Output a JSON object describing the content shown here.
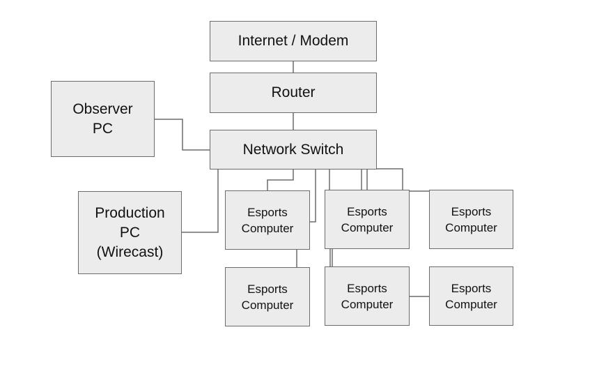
{
  "nodes": {
    "internet": "Internet / Modem",
    "router": "Router",
    "observer": "Observer\nPC",
    "switch": "Network Switch",
    "production": "Production\nPC\n(Wirecast)",
    "esports": [
      "Esports\nComputer",
      "Esports\nComputer",
      "Esports\nComputer",
      "Esports\nComputer",
      "Esports\nComputer",
      "Esports\nComputer"
    ]
  },
  "colors": {
    "box_fill": "#ececec",
    "box_border": "#6b6b6b",
    "line": "#6b6b6b"
  }
}
